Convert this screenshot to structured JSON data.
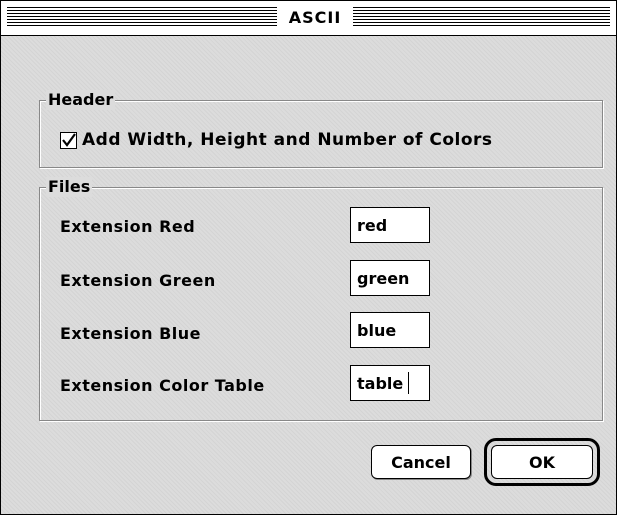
{
  "window": {
    "title": "ASCII"
  },
  "header_group": {
    "title": "Header",
    "checkbox_label": "Add Width, Height and Number of Colors",
    "checked": true
  },
  "files_group": {
    "title": "Files",
    "fields": [
      {
        "label": "Extension Red",
        "value": "red"
      },
      {
        "label": "Extension Green",
        "value": "green"
      },
      {
        "label": "Extension Blue",
        "value": "blue"
      },
      {
        "label": "Extension Color Table",
        "value": "table"
      }
    ]
  },
  "buttons": {
    "cancel": "Cancel",
    "ok": "OK"
  },
  "icons": {
    "checkbox": "checkmark-icon"
  }
}
